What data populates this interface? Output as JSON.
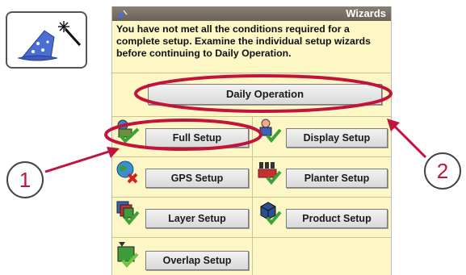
{
  "window": {
    "title": "Wizards"
  },
  "message": "You have not met all the conditions required for a complete setup. Examine the individual setup wizards before continuing to Daily Operation.",
  "daily_operation_label": "Daily Operation",
  "wizards": [
    {
      "label": "Full Setup",
      "icon": "full-setup-icon"
    },
    {
      "label": "Display Setup",
      "icon": "display-setup-icon"
    },
    {
      "label": "GPS Setup",
      "icon": "gps-setup-icon"
    },
    {
      "label": "Planter Setup",
      "icon": "planter-setup-icon"
    },
    {
      "label": "Layer Setup",
      "icon": "layer-setup-icon"
    },
    {
      "label": "Product Setup",
      "icon": "product-setup-icon"
    },
    {
      "label": "Overlap Setup",
      "icon": "overlap-setup-icon"
    }
  ],
  "callouts": {
    "one": "1",
    "two": "2"
  },
  "colors": {
    "panel_bg": "#fdf7c6",
    "annotation_red": "#c0143c",
    "titlebar": "#7a6f64"
  }
}
